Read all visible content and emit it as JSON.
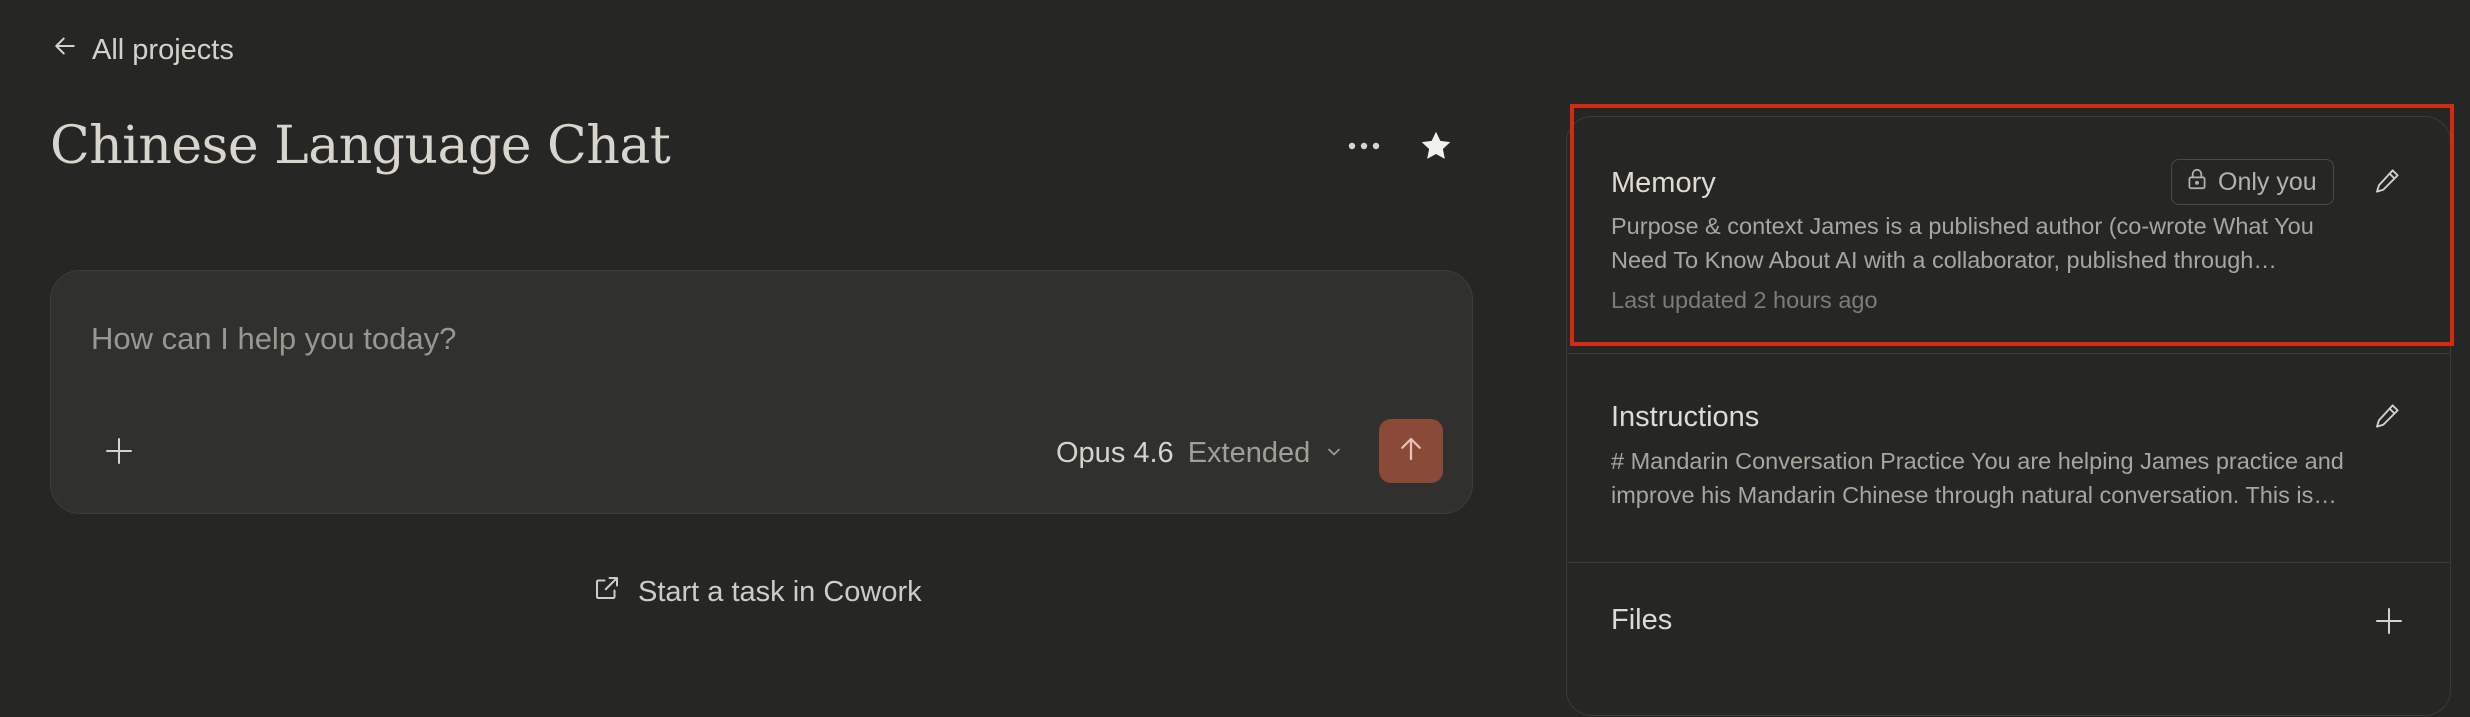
{
  "nav": {
    "back_label": "All projects"
  },
  "project": {
    "title": "Chinese Language Chat"
  },
  "composer": {
    "placeholder": "How can I help you today?",
    "model_name": "Opus 4.6",
    "model_mode": "Extended"
  },
  "cowork": {
    "label": "Start a task in Cowork"
  },
  "panel": {
    "memory": {
      "title": "Memory",
      "badge": "Only you",
      "preview_line1": "Purpose & context James is a published author (co-wrote What You",
      "preview_line2": "Need To Know About AI with a collaborator, published through…",
      "updated": "Last updated 2 hours ago"
    },
    "instructions": {
      "title": "Instructions",
      "preview_line1": "# Mandarin Conversation Practice You are helping James practice and",
      "preview_line2": "improve his Mandarin Chinese through natural conversation. This is…"
    },
    "files": {
      "title": "Files"
    }
  },
  "colors": {
    "background": "#262624",
    "send_button": "#8a4a38",
    "highlight": "#d42a12"
  },
  "icons": [
    "arrow-left-icon",
    "more-horizontal-icon",
    "star-icon",
    "plus-icon",
    "chevron-down-icon",
    "arrow-up-icon",
    "external-link-icon",
    "lock-icon",
    "pencil-icon"
  ]
}
